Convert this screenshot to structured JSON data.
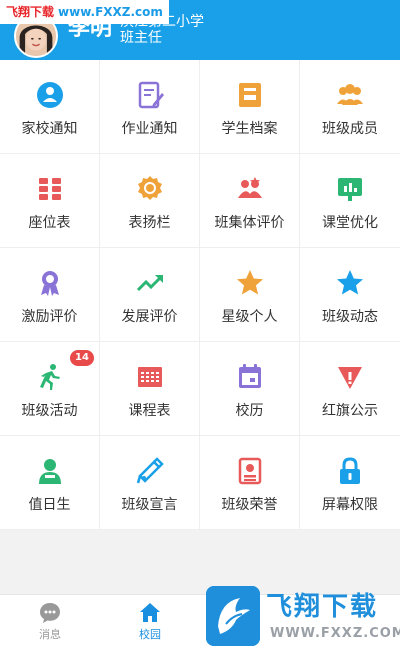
{
  "watermark_top": {
    "brand": "飞翔下载",
    "url": "www.FXXZ.com"
  },
  "header": {
    "user_name": "李明",
    "school": "滨江第二小学",
    "role": "班主任"
  },
  "colors": {
    "header_bg": "#1aa0e8",
    "tab_active": "#1a8fe0",
    "tab_inactive": "#999999",
    "badge": "#e84a4a"
  },
  "grid": [
    {
      "label": "家校通知",
      "icon": "parent-notice-icon",
      "color": "#1aa0e8"
    },
    {
      "label": "作业通知",
      "icon": "homework-notice-icon",
      "color": "#8a73d6"
    },
    {
      "label": "学生档案",
      "icon": "student-file-icon",
      "color": "#f0a23a"
    },
    {
      "label": "班级成员",
      "icon": "class-members-icon",
      "color": "#f0a23a"
    },
    {
      "label": "座位表",
      "icon": "seating-chart-icon",
      "color": "#e85a5a"
    },
    {
      "label": "表扬栏",
      "icon": "praise-board-icon",
      "color": "#f0a23a"
    },
    {
      "label": "班集体评价",
      "icon": "class-evaluation-icon",
      "color": "#e85a5a"
    },
    {
      "label": "课堂优化",
      "icon": "classroom-optimize-icon",
      "color": "#2bb673"
    },
    {
      "label": "激励评价",
      "icon": "incentive-evaluation-icon",
      "color": "#8a73d6"
    },
    {
      "label": "发展评价",
      "icon": "development-evaluation-icon",
      "color": "#2bb673"
    },
    {
      "label": "星级个人",
      "icon": "star-individual-icon",
      "color": "#f0a23a"
    },
    {
      "label": "班级动态",
      "icon": "class-news-icon",
      "color": "#1aa0e8"
    },
    {
      "label": "班级活动",
      "icon": "class-activity-icon",
      "color": "#2bb673",
      "badge": "14"
    },
    {
      "label": "课程表",
      "icon": "timetable-icon",
      "color": "#e85a5a"
    },
    {
      "label": "校历",
      "icon": "school-calendar-icon",
      "color": "#8a73d6"
    },
    {
      "label": "红旗公示",
      "icon": "red-flag-icon",
      "color": "#e85a5a"
    },
    {
      "label": "值日生",
      "icon": "duty-student-icon",
      "color": "#2bb673"
    },
    {
      "label": "班级宣言",
      "icon": "class-declaration-icon",
      "color": "#1aa0e8"
    },
    {
      "label": "班级荣誉",
      "icon": "class-honor-icon",
      "color": "#e85a5a"
    },
    {
      "label": "屏幕权限",
      "icon": "screen-permission-icon",
      "color": "#1aa0e8"
    }
  ],
  "tabbar": [
    {
      "label": "消息",
      "icon": "message-icon",
      "active": false
    },
    {
      "label": "校园",
      "icon": "campus-icon",
      "active": true
    }
  ],
  "watermark_bottom": {
    "title": "飞翔下载",
    "url": "WWW.FXXZ.COM"
  }
}
